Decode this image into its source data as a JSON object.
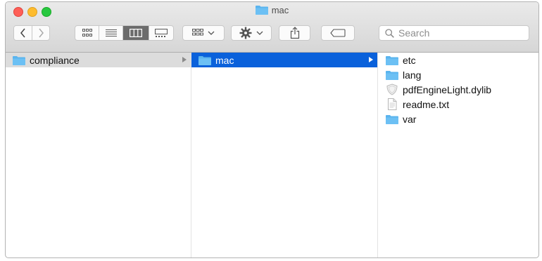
{
  "window": {
    "title": "mac"
  },
  "toolbar": {
    "back_icon": "chevron-left-icon",
    "forward_icon": "chevron-right-icon",
    "view_modes": [
      "icon-view-icon",
      "list-view-icon",
      "column-view-icon",
      "gallery-view-icon"
    ],
    "active_view": "column-view",
    "group_icon": "group-by-icon",
    "action_icon": "gear-icon",
    "share_icon": "share-icon",
    "tag_icon": "tag-icon",
    "search_placeholder": "Search"
  },
  "columns": [
    {
      "items": [
        {
          "name": "compliance",
          "icon": "folder-icon",
          "selected": "inactive",
          "has_children": true
        }
      ]
    },
    {
      "items": [
        {
          "name": "mac",
          "icon": "folder-icon",
          "selected": "active",
          "has_children": true
        }
      ]
    },
    {
      "items": [
        {
          "name": "etc",
          "icon": "folder-icon"
        },
        {
          "name": "lang",
          "icon": "folder-icon"
        },
        {
          "name": "pdfEngineLight.dylib",
          "icon": "dylib-icon"
        },
        {
          "name": "readme.txt",
          "icon": "text-file-icon"
        },
        {
          "name": "var",
          "icon": "folder-icon"
        }
      ]
    }
  ],
  "colors": {
    "selection_active": "#0a61db",
    "selection_inactive": "#dcdcdc",
    "folder": "#5ab4ee"
  }
}
